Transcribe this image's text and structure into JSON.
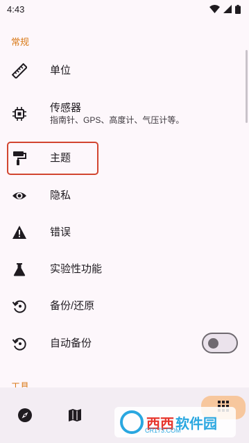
{
  "status_bar": {
    "time": "4:43"
  },
  "sections": {
    "general": "常规",
    "tools": "工具"
  },
  "settings": {
    "units": {
      "label": "单位"
    },
    "sensors": {
      "label": "传感器",
      "sub": "指南针、GPS、高度计、气压计等。"
    },
    "theme": {
      "label": "主题"
    },
    "privacy": {
      "label": "隐私"
    },
    "errors": {
      "label": "错误"
    },
    "experimental": {
      "label": "实验性功能"
    },
    "backup_restore": {
      "label": "备份/还原"
    },
    "auto_backup": {
      "label": "自动备份",
      "enabled": false
    }
  },
  "bottom_nav": {
    "items": [
      "compass-icon",
      "map-icon",
      "tools-icon"
    ]
  },
  "watermark": {
    "brand_a": "西西",
    "brand_b": "软件园",
    "domain": "CR173.COM"
  },
  "colors": {
    "accent": "#d97a18",
    "highlight": "#d2452f",
    "background": "#fdf7fb",
    "fab": "#f7c79d"
  }
}
